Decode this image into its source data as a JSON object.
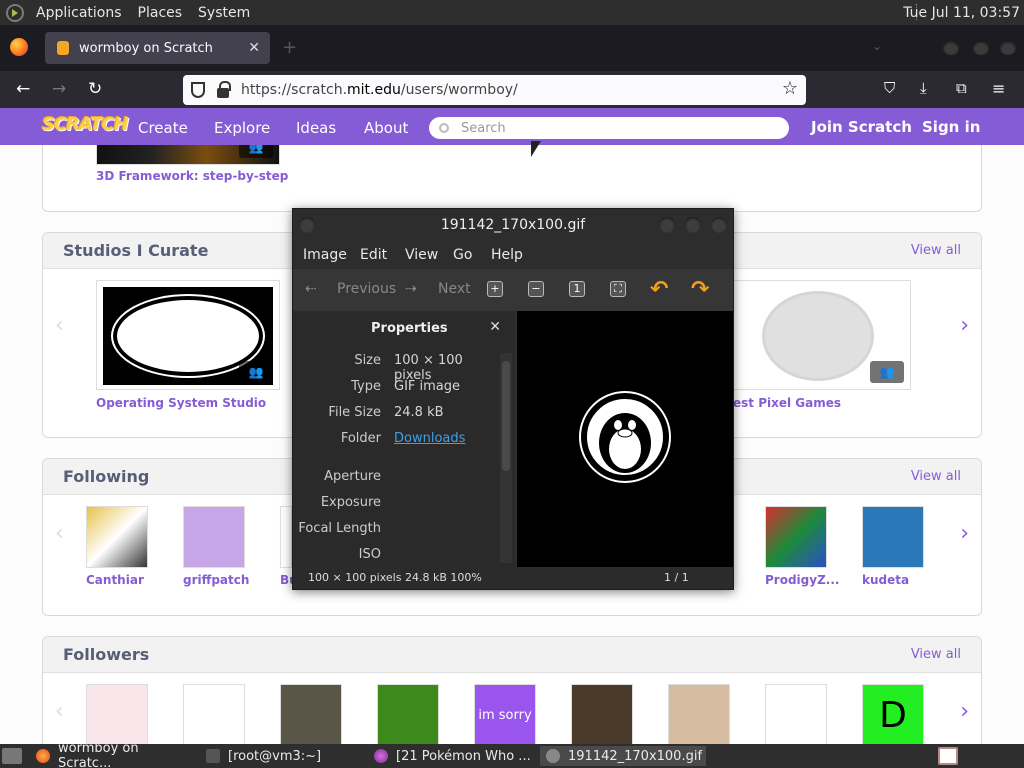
{
  "top_panel": {
    "menus": [
      "Applications",
      "Places",
      "System"
    ],
    "clock": "Tue Jul 11, 03:57"
  },
  "browser": {
    "tab_title": "wormboy on Scratch",
    "url_prefix": "https://scratch.",
    "url_domain": "mit.edu",
    "url_suffix": "/users/wormboy/"
  },
  "scratch_nav": {
    "logo": "SCRATCH",
    "items": [
      "Create",
      "Explore",
      "Ideas",
      "About"
    ],
    "search_placeholder": "Search",
    "join": "Join Scratch",
    "signin": "Sign in"
  },
  "sections": {
    "top_partial": {
      "item_title": "3D Framework: step-by-step"
    },
    "studios": {
      "title": "Studios I Curate",
      "view_all": "View all",
      "items": [
        "Operating System Studio",
        "est Pixel Games"
      ]
    },
    "following": {
      "title": "Following",
      "view_all": "View all",
      "users": [
        "Canthiar",
        "griffpatch",
        "Bu",
        "ProdigyZ...",
        "kudeta"
      ]
    },
    "followers": {
      "title": "Followers",
      "view_all": "View all",
      "thumb_text_1": "im sorry",
      "thumb_text_2": "D"
    }
  },
  "image_viewer": {
    "title": "191142_170x100.gif",
    "menu": [
      "Image",
      "Edit",
      "View",
      "Go",
      "Help"
    ],
    "toolbar": {
      "previous": "Previous",
      "next": "Next"
    },
    "properties": {
      "header": "Properties",
      "rows": [
        {
          "key": "Size",
          "value": "100 × 100 pixels"
        },
        {
          "key": "Type",
          "value": "GIF image"
        },
        {
          "key": "File Size",
          "value": "24.8 kB"
        },
        {
          "key": "Folder",
          "value": "Downloads"
        },
        {
          "key": "Aperture",
          "value": ""
        },
        {
          "key": "Exposure",
          "value": ""
        },
        {
          "key": "Focal Length",
          "value": ""
        },
        {
          "key": "ISO",
          "value": ""
        }
      ]
    },
    "status_left": "100 × 100 pixels  24.8 kB   100%",
    "status_right": "1 / 1"
  },
  "taskbar": {
    "tasks": [
      "wormboy on Scratc...",
      "[root@vm3:~]",
      "[21 Pokémon Who ...",
      "191142_170x100.gif"
    ]
  },
  "colors": {
    "scratch_purple": "#855cd6",
    "firefox_dark": "#1c1b22"
  }
}
